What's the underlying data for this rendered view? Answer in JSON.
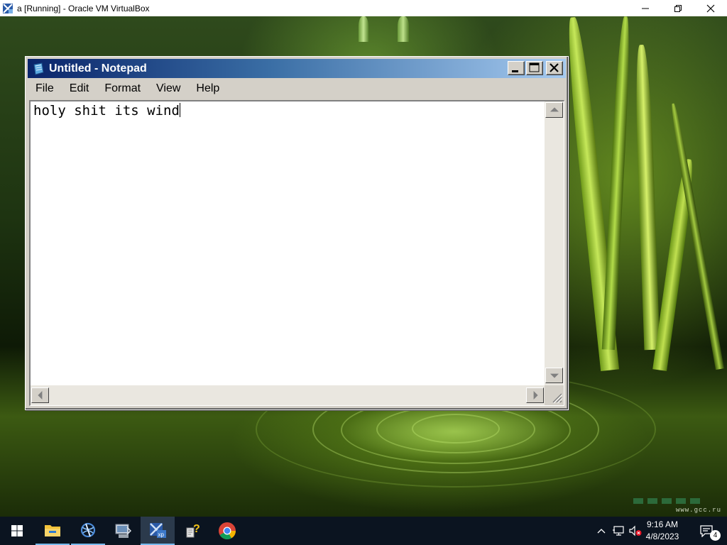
{
  "host_window": {
    "title": "a [Running] - Oracle VM VirtualBox",
    "icon": "virtualbox-icon",
    "controls": [
      "minimize-icon",
      "restore-icon",
      "close-icon"
    ]
  },
  "notepad": {
    "title": "Untitled - Notepad",
    "icon": "notepad-icon",
    "menu": [
      "File",
      "Edit",
      "Format",
      "View",
      "Help"
    ],
    "content": "holy shit its wind"
  },
  "desktop": {
    "watermark": "www.gcc.ru"
  },
  "taskbar": {
    "pinned": [
      {
        "name": "start-button",
        "icon": "windows-logo-icon"
      },
      {
        "name": "file-explorer",
        "icon": "folder-icon"
      },
      {
        "name": "app-globe",
        "icon": "globe-icon"
      },
      {
        "name": "app-computer",
        "icon": "computer-icon"
      },
      {
        "name": "virtualbox-xp",
        "icon": "virtualbox-xp-icon",
        "active": true
      },
      {
        "name": "help-app",
        "icon": "help-icon"
      },
      {
        "name": "chrome",
        "icon": "chrome-icon"
      }
    ],
    "tray": [
      "chevron-up-icon",
      "network-icon",
      "volume-muted-icon"
    ],
    "clock": {
      "time": "9:16 AM",
      "date": "4/8/2023"
    },
    "notifications": {
      "icon": "notification-icon",
      "count": "4"
    }
  },
  "colors": {
    "taskbar": "#0b1420",
    "notepad_titlebar_start": "#0a246a",
    "notepad_titlebar_end": "#a6caf0",
    "accent": "#76b9ed"
  }
}
